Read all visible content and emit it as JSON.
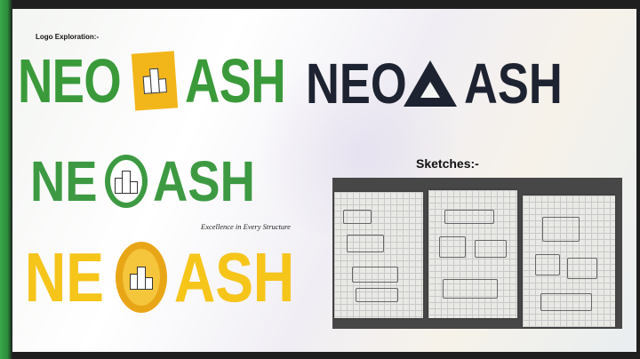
{
  "heading": "Logo Exploration:-",
  "logo_text": {
    "part1": "NEO",
    "part2": "ASH"
  },
  "tagline": "Excellence in Every Structure",
  "sketches_label": "Sketches:-",
  "colors": {
    "green": "#3a9a3a",
    "yellow": "#f5c21a",
    "navy": "#1d2330",
    "orange": "#e8a617"
  },
  "icons": [
    "building-icon",
    "triangle-a-mark",
    "sketch-paper"
  ]
}
